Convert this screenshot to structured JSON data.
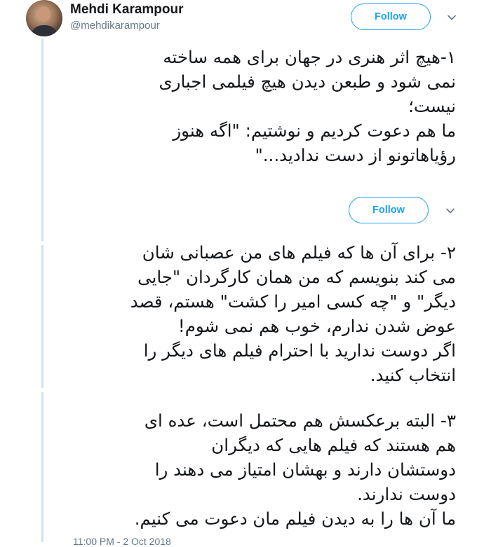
{
  "author": {
    "name": "Mehdi Karampour",
    "handle": "@mehdikarampour"
  },
  "follow_label": "Follow",
  "tweets": [
    {
      "text": "۱-هیچ اثر هنری در جهان برای همه ساخته\nنمی شود و طبعن دیدن هیچ فیلمی اجباری\nنیست؛\nما هم دعوت کردیم و نوشتیم: \"اگه هنوز\nرؤیاهاتونو از دست ندادید...\""
    },
    {
      "text": "۲- برای آن ها که فیلم های من عصبانی شان\nمی کند بنویسم که من همان کارگردان \"جایی\nدیگر\" و \"چه کسی امیر را کشت\" هستم، قصد\nعوض شدن ندارم، خوب هم نمی شوم!\nاگر دوست ندارید با احترام فیلم های دیگر را\nانتخاب کنید."
    },
    {
      "text": "۳- البته برعکسش هم محتمل است، عده ای\nهم هستند که فیلم هایی که دیگران\nدوستشان دارند و بهشان امتیاز می دهند را\nدوست ندارند.\nما آن ها را به دیدن فیلم مان دعوت می کنیم."
    }
  ],
  "timestamp": "11:00 PM - 2 Oct 2018",
  "colors": {
    "accent": "#1da1f2",
    "thread_line": "#cfe3f5",
    "secondary_text": "#657786"
  }
}
